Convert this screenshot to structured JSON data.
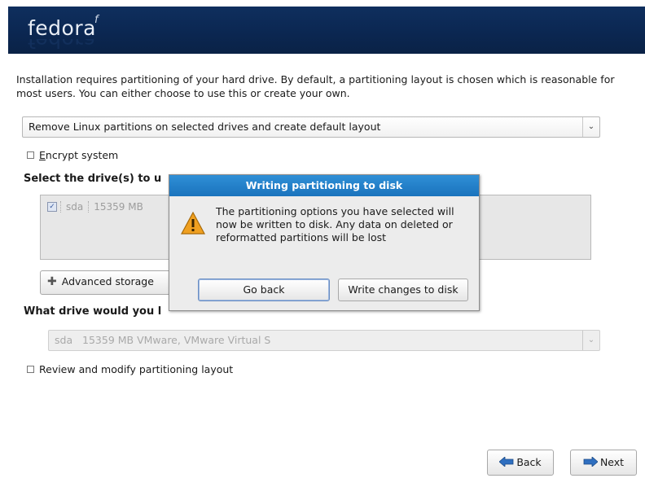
{
  "header": {
    "logo_text": "fedora",
    "logo_mark": "f"
  },
  "intro_text": "Installation requires partitioning of your hard drive.  By default, a partitioning layout is chosen which is reasonable for most users.  You can either choose to use this or create your own.",
  "layout_select": {
    "value": "Remove Linux partitions on selected drives and create default layout"
  },
  "encrypt": {
    "label": "Encrypt system",
    "checked": false
  },
  "select_drives_heading": "Select the drive(s) to u",
  "drive_list": {
    "drive": "sda",
    "size": "15359 MB",
    "checked": true
  },
  "advanced_button": "Advanced storage",
  "boot_drive_heading": "What drive would you l",
  "boot_drive_select": {
    "value": "sda   15359 MB VMware, VMware Virtual S",
    "disabled": true
  },
  "review": {
    "label": "Review and modify partitioning layout",
    "checked": false
  },
  "dialog": {
    "title": "Writing partitioning to disk",
    "message": "The partitioning options you have selected will now be written to disk.  Any data on deleted or reformatted partitions will be lost",
    "go_back": "Go back",
    "write_changes": "Write changes to disk"
  },
  "nav": {
    "back": "Back",
    "next": "Next"
  },
  "colors": {
    "header": "#0b2752",
    "dialog_title": "#1f7bc4",
    "warning": "#f0a020"
  }
}
